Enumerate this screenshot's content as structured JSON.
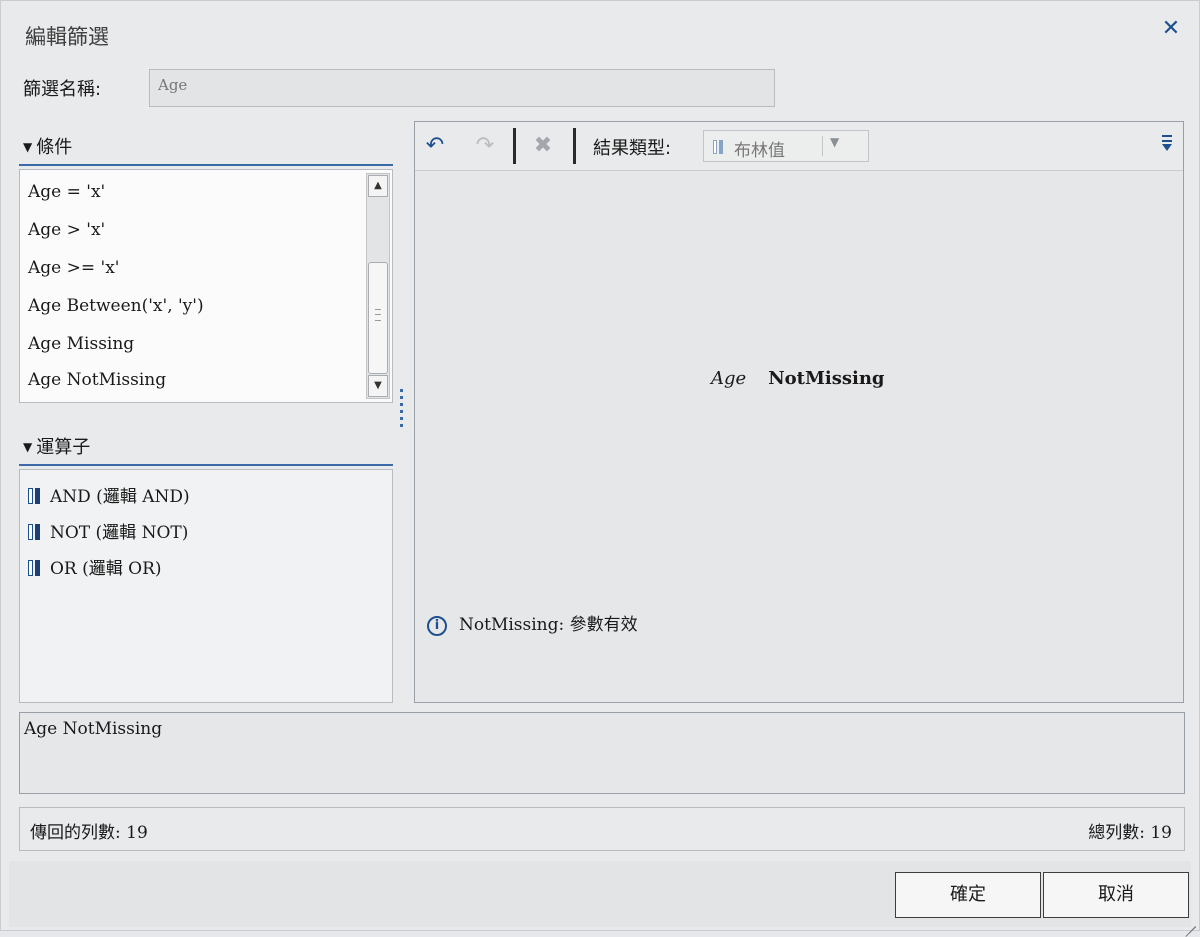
{
  "dialog": {
    "title": "編輯篩選",
    "close_icon": "close-icon"
  },
  "filter_name": {
    "label": "篩選名稱:",
    "value": "Age"
  },
  "conditions": {
    "header": "條件",
    "items": [
      "Age = 'x'",
      "Age > 'x'",
      "Age >= 'x'",
      "Age Between('x', 'y')",
      "Age Missing",
      "Age NotMissing"
    ]
  },
  "operators": {
    "header": "運算子",
    "items": [
      "AND (邏輯 AND)",
      "NOT (邏輯 NOT)",
      "OR (邏輯 OR)"
    ]
  },
  "toolbar": {
    "result_type_label": "結果類型:",
    "result_type_value": "布林值",
    "icons": [
      "undo-icon",
      "redo-icon",
      "delete-icon",
      "overflow-menu-icon"
    ]
  },
  "expression": {
    "variable": "Age",
    "function": "NotMissing"
  },
  "info_message": "NotMissing: 參數有效",
  "summary_text": "Age NotMissing",
  "status": {
    "returned_rows": "傳回的列數: 19",
    "total_rows": "總列數: 19"
  },
  "buttons": {
    "ok": "確定",
    "cancel": "取消"
  },
  "colors": {
    "accent": "#1e4f8f",
    "glyph_light": "#5b7fb0",
    "glyph_dark": "#1e3f6f",
    "panel_bg": "#e9eaec"
  }
}
